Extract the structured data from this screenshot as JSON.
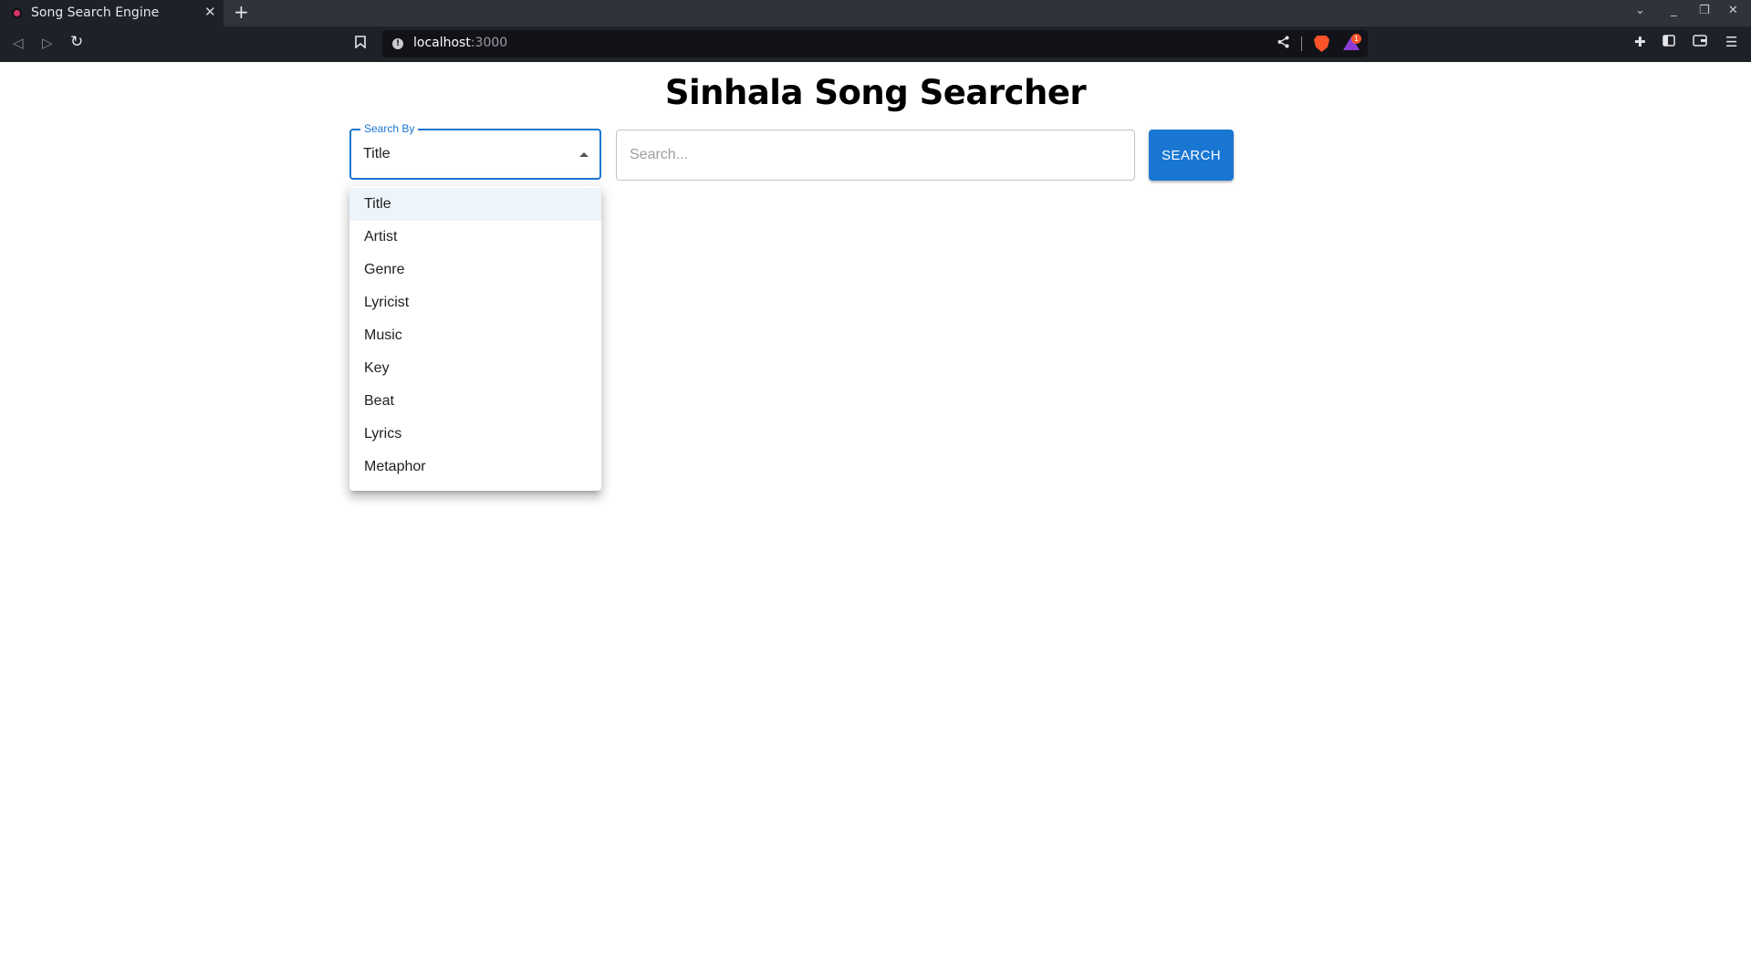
{
  "browser": {
    "tab_title": "Song Search Engine",
    "tab_close": "✕",
    "new_tab": "+",
    "url_host": "localhost",
    "url_port": ":3000",
    "rewards_count": "1"
  },
  "page": {
    "title": "Sinhala Song Searcher"
  },
  "search_by": {
    "label": "Search By",
    "selected": "Title",
    "options": [
      "Title",
      "Artist",
      "Genre",
      "Lyricist",
      "Music",
      "Key",
      "Beat",
      "Lyrics",
      "Metaphor"
    ],
    "selected_index": 0
  },
  "search": {
    "placeholder": "Search...",
    "value": ""
  },
  "search_button": {
    "label": "SEARCH"
  },
  "colors": {
    "accent": "#1976d2",
    "selected_item_bg": "#edf4fb",
    "chrome_dark": "#1f2129"
  }
}
